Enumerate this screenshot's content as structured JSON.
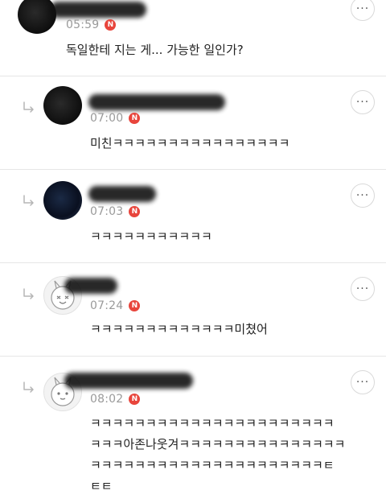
{
  "icons": {
    "reply": "reply-arrow-icon",
    "more": "more-options-icon",
    "new": "new-badge"
  },
  "colors": {
    "new_badge": "#e8453c",
    "time_text": "#9a9a9a",
    "body_text": "#222222",
    "divider": "#e6e6e6"
  },
  "new_badge_label": "N",
  "more_label": "···",
  "comments": [
    {
      "time": "05:59",
      "text": "독일한테 지는 게... 가능한 일인가?"
    },
    {
      "time": "07:00",
      "text": "미친ㅋㅋㅋㅋㅋㅋㅋㅋㅋㅋㅋㅋㅋㅋㅋㅋ"
    },
    {
      "time": "07:03",
      "text": "ㅋㅋㅋㅋㅋㅋㅋㅋㅋㅋㅋ"
    },
    {
      "time": "07:24",
      "text": "ㅋㅋㅋㅋㅋㅋㅋㅋㅋㅋㅋㅋㅋ미쳤어"
    },
    {
      "time": "08:02",
      "text": "ㅋㅋㅋㅋㅋㅋㅋㅋㅋㅋㅋㅋㅋㅋㅋㅋㅋㅋㅋㅋㅋㅋ\nㅋㅋㅋ아존나웃겨ㅋㅋㅋㅋㅋㅋㅋㅋㅋㅋㅋㅋㅋㅋㅋ\nㅋㅋㅋㅋㅋㅋㅋㅋㅋㅋㅋㅋㅋㅋㅋㅋㅋㅋㅋㅋㅋㅌ\nㅌㅌ"
    }
  ]
}
